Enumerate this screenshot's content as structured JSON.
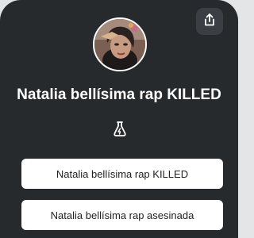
{
  "profile": {
    "title": "Natalia bellísima rap KILLED"
  },
  "links": [
    {
      "label": "Natalia bellísima rap KILLED"
    },
    {
      "label": "Natalia bellísima rap asesinada"
    }
  ],
  "icons": {
    "share": "share-icon",
    "brand": "linkfire-bolt-icon"
  },
  "colors": {
    "background": "#262a2d",
    "page": "#e4e5e7",
    "button": "#ffffff",
    "share_button": "#3b3f43",
    "text_light": "#ffffff",
    "text_dark": "#222222"
  }
}
